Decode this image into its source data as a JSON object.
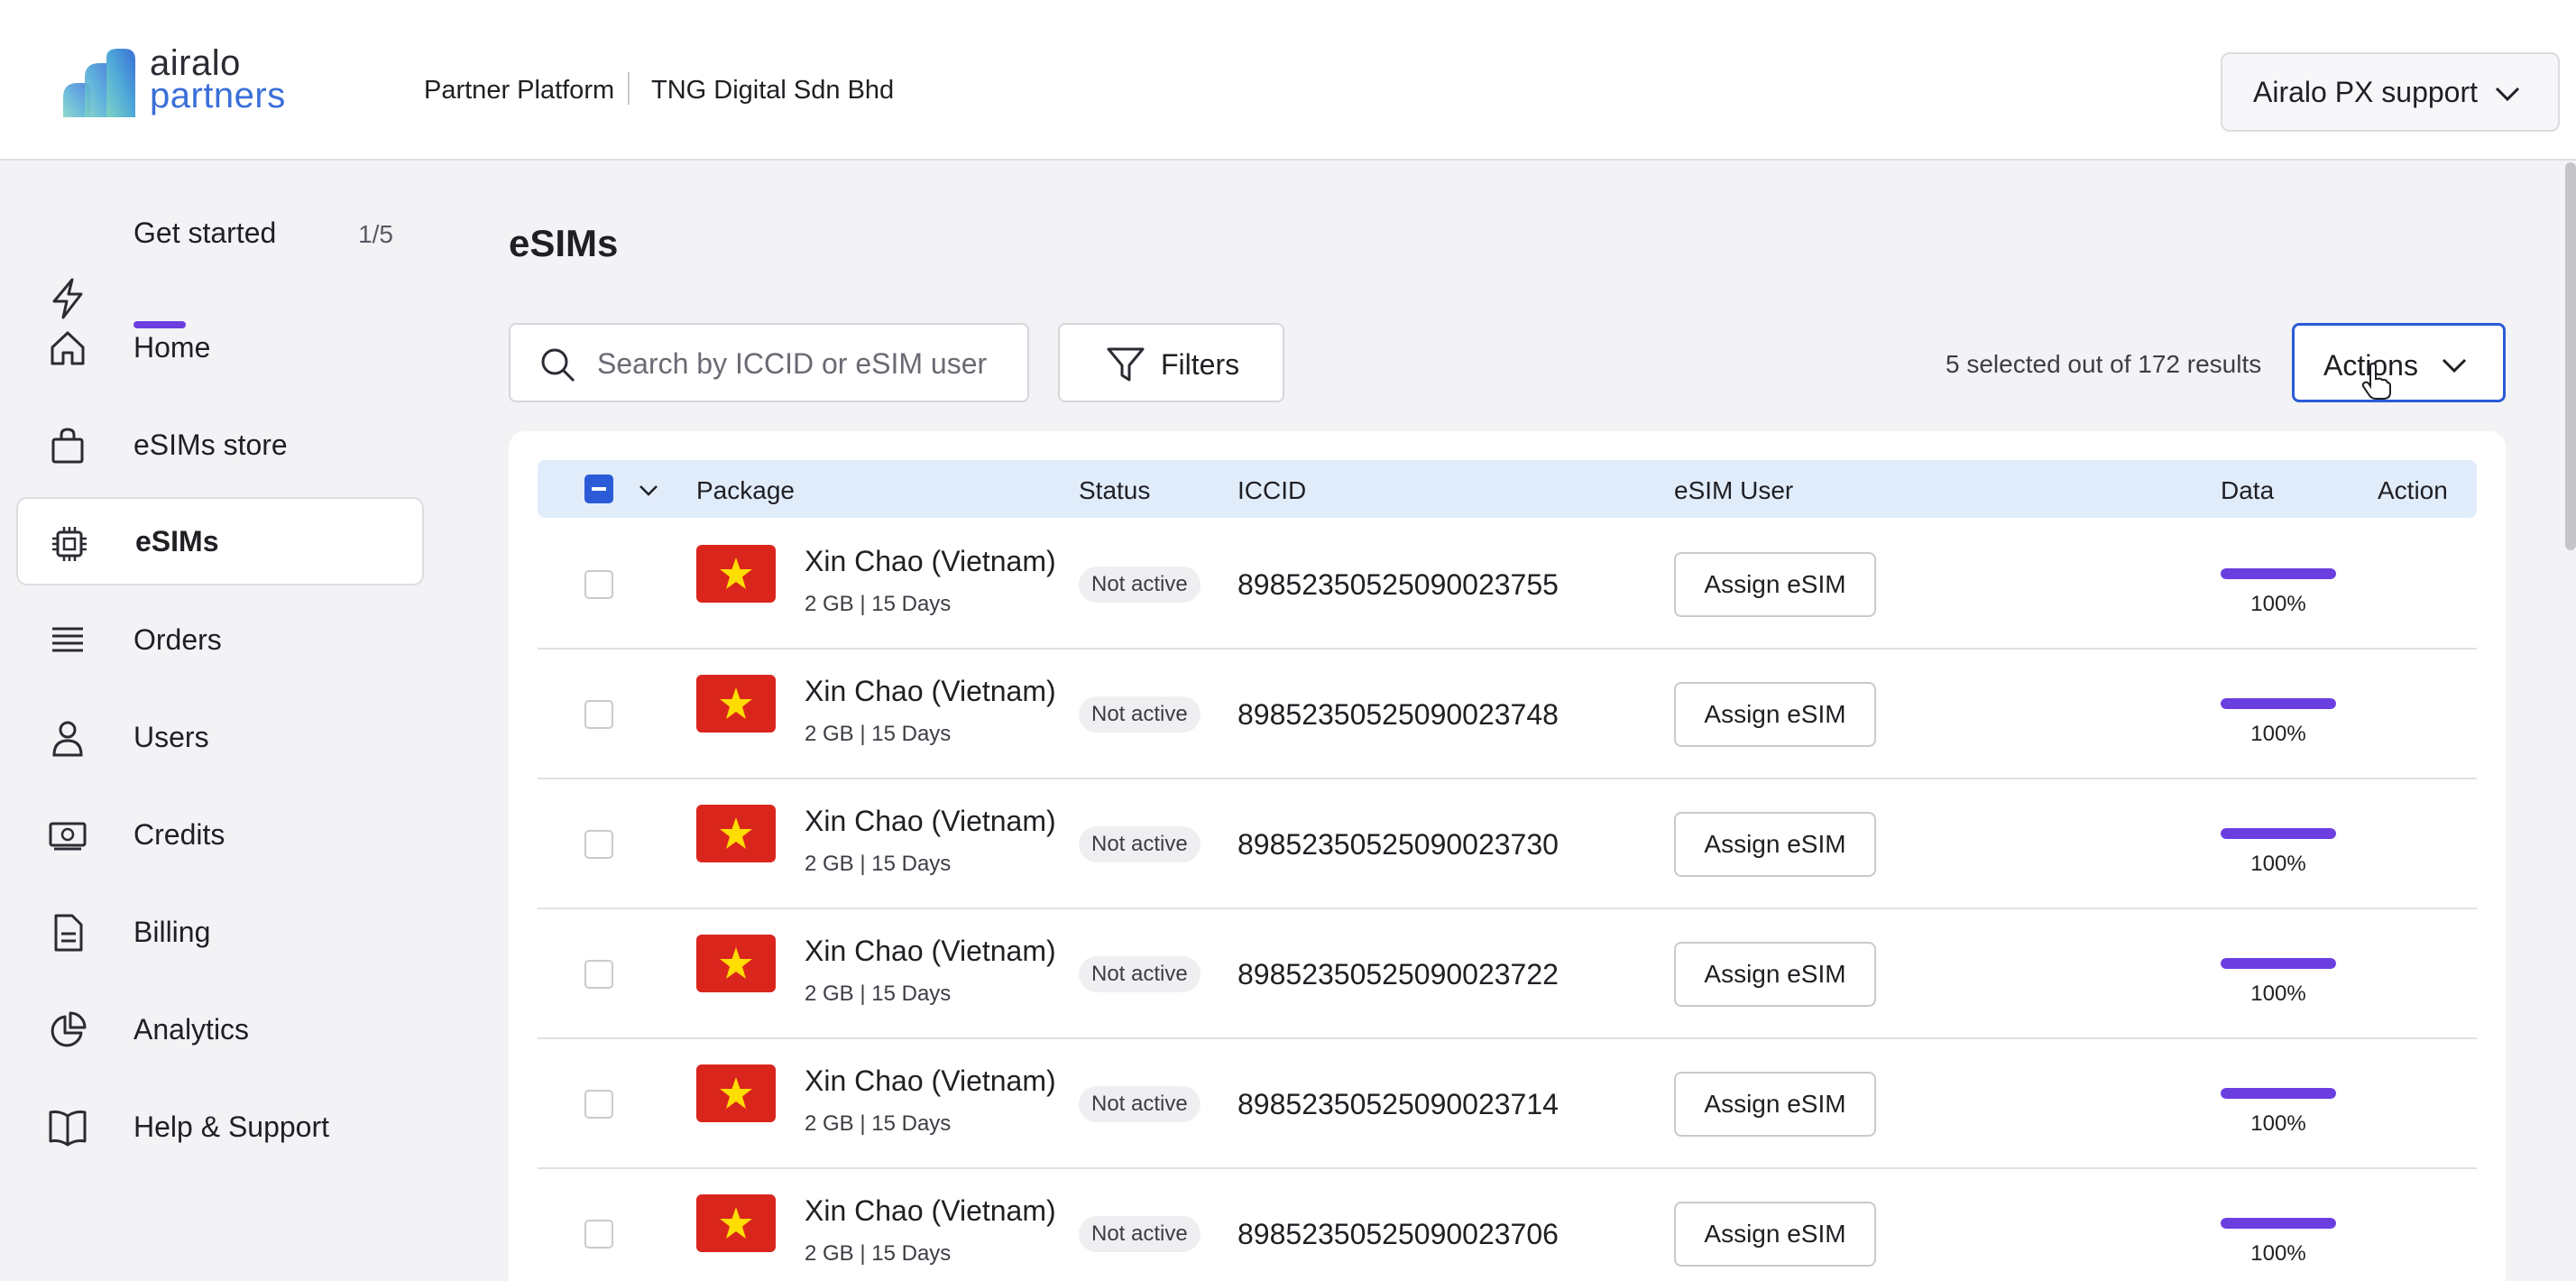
{
  "header": {
    "logo_line1": "airalo",
    "logo_line2": "partners",
    "platform": "Partner Platform",
    "company": "TNG Digital Sdn Bhd",
    "account": "Airalo PX support"
  },
  "sidebar": {
    "get_started": {
      "label": "Get started",
      "progress": "1/5"
    },
    "items": [
      {
        "label": "Home",
        "icon": "home-icon"
      },
      {
        "label": "eSIMs store",
        "icon": "shopping-bag-icon"
      },
      {
        "label": "eSIMs",
        "icon": "chip-icon",
        "active": true
      },
      {
        "label": "Orders",
        "icon": "stack-icon"
      },
      {
        "label": "Users",
        "icon": "user-icon"
      },
      {
        "label": "Credits",
        "icon": "money-icon"
      },
      {
        "label": "Billing",
        "icon": "document-icon"
      },
      {
        "label": "Analytics",
        "icon": "pie-chart-icon"
      },
      {
        "label": "Help & Support",
        "icon": "book-icon"
      }
    ]
  },
  "main": {
    "title": "eSIMs",
    "search": {
      "placeholder": "Search by ICCID or eSIM user",
      "value": ""
    },
    "filters_label": "Filters",
    "results_text": "5 selected out of 172 results",
    "actions_label": "Actions"
  },
  "table": {
    "headers": {
      "package": "Package",
      "status": "Status",
      "iccid": "ICCID",
      "user": "eSIM User",
      "data": "Data",
      "action": "Action"
    },
    "rows": [
      {
        "package": "Xin Chao (Vietnam)",
        "meta": "2 GB | 15 Days",
        "status": "Not active",
        "iccid": "89852350525090023755",
        "assign": "Assign eSIM",
        "data_percent": "100%",
        "data_fraction": 1.0
      },
      {
        "package": "Xin Chao (Vietnam)",
        "meta": "2 GB | 15 Days",
        "status": "Not active",
        "iccid": "89852350525090023748",
        "assign": "Assign eSIM",
        "data_percent": "100%",
        "data_fraction": 1.0
      },
      {
        "package": "Xin Chao (Vietnam)",
        "meta": "2 GB | 15 Days",
        "status": "Not active",
        "iccid": "89852350525090023730",
        "assign": "Assign eSIM",
        "data_percent": "100%",
        "data_fraction": 1.0
      },
      {
        "package": "Xin Chao (Vietnam)",
        "meta": "2 GB | 15 Days",
        "status": "Not active",
        "iccid": "89852350525090023722",
        "assign": "Assign eSIM",
        "data_percent": "100%",
        "data_fraction": 1.0
      },
      {
        "package": "Xin Chao (Vietnam)",
        "meta": "2 GB | 15 Days",
        "status": "Not active",
        "iccid": "89852350525090023714",
        "assign": "Assign eSIM",
        "data_percent": "100%",
        "data_fraction": 1.0
      },
      {
        "package": "Xin Chao (Vietnam)",
        "meta": "2 GB | 15 Days",
        "status": "Not active",
        "iccid": "89852350525090023706",
        "assign": "Assign eSIM",
        "data_percent": "100%",
        "data_fraction": 1.0
      }
    ]
  },
  "colors": {
    "accent": "#6b3ee0",
    "primary_blue": "#2b5bd7",
    "flag_red": "#da251d",
    "flag_star": "#ffdd00",
    "header_row_bg": "#e1ecfb"
  }
}
